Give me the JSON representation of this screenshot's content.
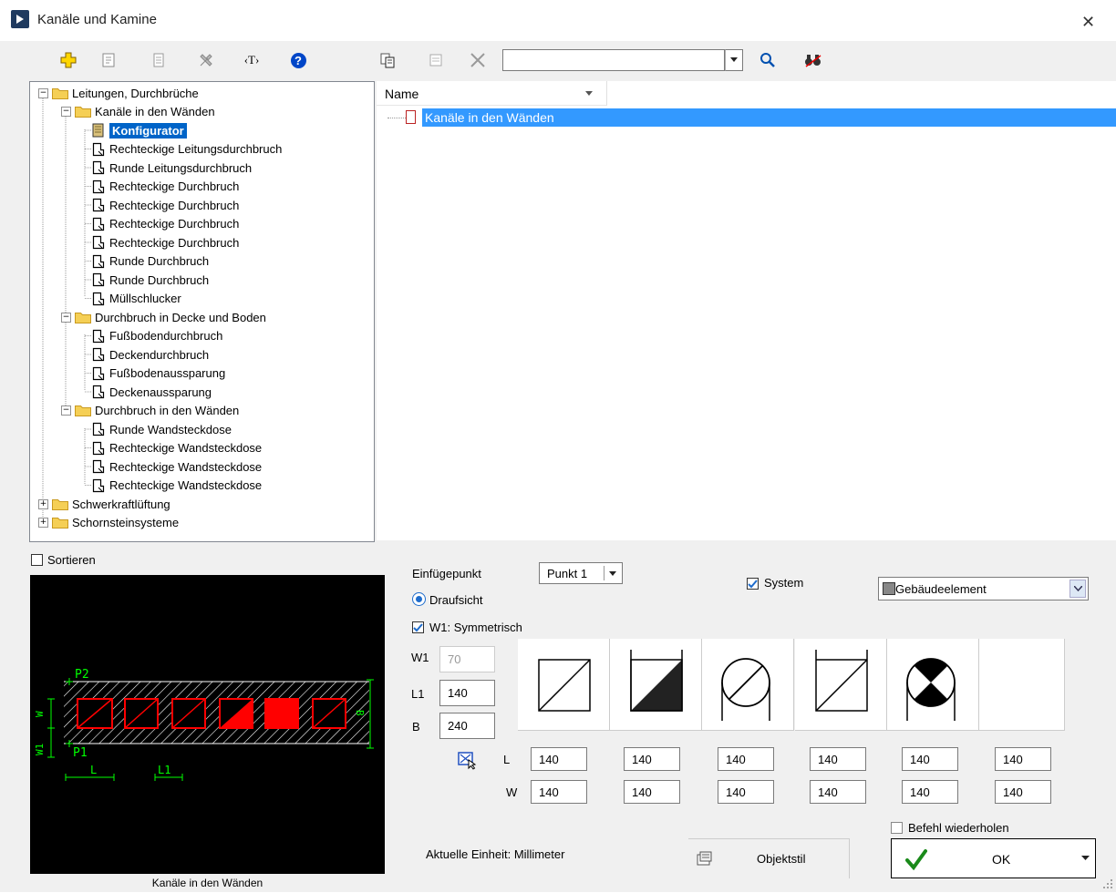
{
  "window": {
    "title": "Kanäle und Kamine",
    "close_glyph": "✕"
  },
  "toolbar": {
    "search": {
      "value": "",
      "placeholder": ""
    },
    "tag_label": "‹T›",
    "help_glyph": "?"
  },
  "tree": [
    {
      "label": "Leitungen, Durchbrüche",
      "level": 0,
      "type": "folder",
      "expanded": true
    },
    {
      "label": "Kanäle in den Wänden",
      "level": 1,
      "type": "folder",
      "expanded": true
    },
    {
      "label": "Konfigurator",
      "level": 2,
      "type": "item",
      "selected": true
    },
    {
      "label": "Rechteckige Leitungsdurchbruch",
      "level": 2,
      "type": "item"
    },
    {
      "label": "Runde Leitungsdurchbruch",
      "level": 2,
      "type": "item"
    },
    {
      "label": "Rechteckige Durchbruch",
      "level": 2,
      "type": "item"
    },
    {
      "label": "Rechteckige Durchbruch",
      "level": 2,
      "type": "item"
    },
    {
      "label": "Rechteckige Durchbruch",
      "level": 2,
      "type": "item"
    },
    {
      "label": "Rechteckige Durchbruch",
      "level": 2,
      "type": "item"
    },
    {
      "label": "Runde Durchbruch",
      "level": 2,
      "type": "item"
    },
    {
      "label": "Runde Durchbruch",
      "level": 2,
      "type": "item"
    },
    {
      "label": "Müllschlucker",
      "level": 2,
      "type": "item"
    },
    {
      "label": "Durchbruch in Decke und Boden",
      "level": 1,
      "type": "folder",
      "expanded": true
    },
    {
      "label": "Fußbodendurchbruch",
      "level": 2,
      "type": "item"
    },
    {
      "label": "Deckendurchbruch",
      "level": 2,
      "type": "item"
    },
    {
      "label": "Fußbodenaussparung",
      "level": 2,
      "type": "item"
    },
    {
      "label": "Deckenaussparung",
      "level": 2,
      "type": "item"
    },
    {
      "label": "Durchbruch in den Wänden",
      "level": 1,
      "type": "folder",
      "expanded": true
    },
    {
      "label": "Runde Wandsteckdose",
      "level": 2,
      "type": "item"
    },
    {
      "label": "Rechteckige Wandsteckdose",
      "level": 2,
      "type": "item"
    },
    {
      "label": "Rechteckige Wandsteckdose",
      "level": 2,
      "type": "item"
    },
    {
      "label": "Rechteckige Wandsteckdose",
      "level": 2,
      "type": "item"
    },
    {
      "label": "Schwerkraftlüftung",
      "level": 0,
      "type": "folder",
      "expanded": false
    },
    {
      "label": "Schornsteinsysteme",
      "level": 0,
      "type": "folder",
      "expanded": false
    }
  ],
  "list": {
    "column_header": "Name",
    "rows": [
      {
        "label": "Kanäle in den Wänden",
        "selected": true
      }
    ]
  },
  "sort": {
    "label": "Sortieren",
    "checked": false
  },
  "preview": {
    "caption": "Kanäle in den Wänden",
    "labels": {
      "p2": "P2",
      "p1": "P1",
      "w": "W",
      "w1": "W1",
      "l": "L",
      "l1": "L1",
      "b": "B"
    }
  },
  "config": {
    "insertion_point_label": "Einfügepunkt",
    "insertion_point_value": "Punkt 1",
    "draufsicht_label": "Draufsicht",
    "system_label": "System",
    "system_checked": true,
    "layer_value": "Gebäudeelement",
    "w1_symmetric_label": "W1: Symmetrisch",
    "w1_symmetric_checked": true,
    "w1_label": "W1",
    "w1_value": "70",
    "l1_label": "L1",
    "l1_value": "140",
    "b_label": "B",
    "b_value": "240",
    "l_label": "L",
    "w_label": "W",
    "l_values": [
      "140",
      "140",
      "140",
      "140",
      "140",
      "140"
    ],
    "w_values": [
      "140",
      "140",
      "140",
      "140",
      "140",
      "140"
    ],
    "unit_text": "Aktuelle Einheit: Millimeter",
    "objektstil_label": "Objektstil",
    "repeat_label": "Befehl wiederholen",
    "repeat_checked": false,
    "ok_label": "OK",
    "tile_icons": [
      "rect-diagonal-icon",
      "rect-half-filled-icon",
      "round-diagonal-icon",
      "rect-open-top-icon",
      "round-quarters-icon",
      "empty-tile"
    ]
  },
  "colors": {
    "selection": "#3399ff",
    "accent_blue": "#0064c8",
    "preview_bg": "#000000",
    "preview_red": "#ff0000",
    "preview_green": "#00ff00"
  }
}
